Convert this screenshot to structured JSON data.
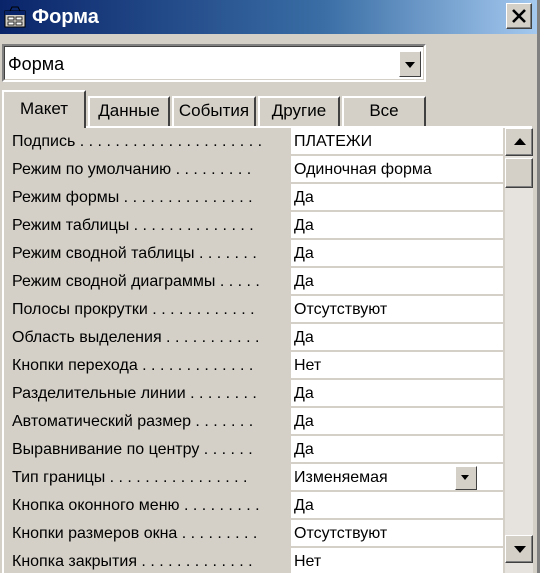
{
  "window": {
    "title": "Форма",
    "title_icon": "form-icon",
    "close_icon": "close-icon"
  },
  "selector": {
    "value": "Форма"
  },
  "tabs": [
    {
      "label": "Макет",
      "active": true
    },
    {
      "label": "Данные",
      "active": false
    },
    {
      "label": "События",
      "active": false
    },
    {
      "label": "Другие",
      "active": false
    },
    {
      "label": "Все",
      "active": false
    }
  ],
  "properties": [
    {
      "name": "Подпись . . . . . . . . . . . . . . . . . . . . .",
      "value": "ПЛАТЕЖИ"
    },
    {
      "name": "Режим по умолчанию . . . . . . . . .",
      "value": "Одиночная форма"
    },
    {
      "name": "Режим формы . . . . . . . . . . . . . . .",
      "value": "Да"
    },
    {
      "name": "Режим таблицы . . . . . . . . . . . . . .",
      "value": "Да"
    },
    {
      "name": "Режим сводной таблицы . . . . . . .",
      "value": "Да"
    },
    {
      "name": "Режим сводной диаграммы . . . . .",
      "value": "Да"
    },
    {
      "name": "Полосы прокрутки . . . . . . . . . . . .",
      "value": "Отсутствуют"
    },
    {
      "name": "Область выделения . . . . . . . . . . .",
      "value": "Да"
    },
    {
      "name": "Кнопки перехода . . . . . . . . . . . . .",
      "value": "Нет"
    },
    {
      "name": "Разделительные линии . . . . . . . .",
      "value": "Да"
    },
    {
      "name": "Автоматический размер . . . . . . .",
      "value": "Да"
    },
    {
      "name": "Выравнивание по центру . . . . . .",
      "value": "Да"
    },
    {
      "name": "Тип границы . . . . . . . . . . . . . . . .",
      "value": "Изменяемая"
    },
    {
      "name": "Кнопка оконного меню . . . . . . . . .",
      "value": "Да"
    },
    {
      "name": "Кнопки размеров окна . . . . . . . . .",
      "value": "Отсутствуют"
    },
    {
      "name": "Кнопка закрытия . . . . . . . . . . . . .",
      "value": "Нет"
    }
  ],
  "scrollbar": {
    "up_icon": "scroll-up-arrow-icon",
    "down_icon": "scroll-down-arrow-icon"
  },
  "colors": {
    "titlebar_start": "#0a246a",
    "titlebar_end": "#a6caf0",
    "face": "#d4d0c8"
  }
}
